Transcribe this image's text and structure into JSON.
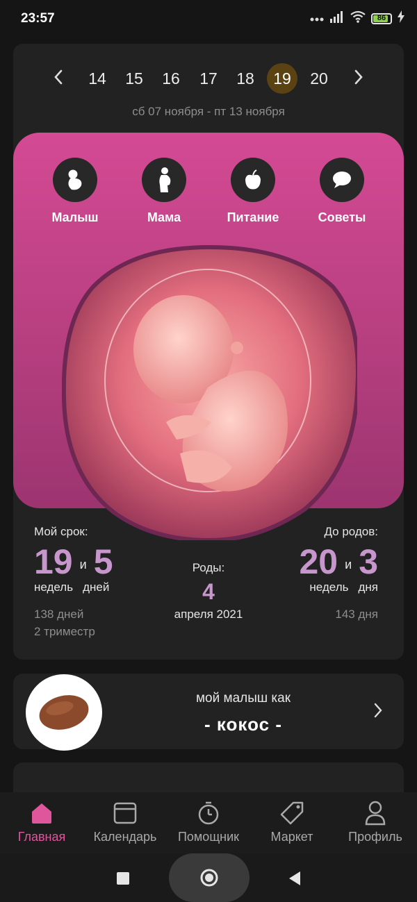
{
  "status": {
    "time": "23:57",
    "battery": "86"
  },
  "weeks": {
    "items": [
      "14",
      "15",
      "16",
      "17",
      "18",
      "19",
      "20"
    ],
    "active": "19",
    "date_range": "сб 07 ноября - пт 13 ноября"
  },
  "categories": [
    {
      "label": "Малыш",
      "icon": "baby-icon"
    },
    {
      "label": "Мама",
      "icon": "pregnant-woman-icon"
    },
    {
      "label": "Питание",
      "icon": "apple-icon"
    },
    {
      "label": "Советы",
      "icon": "chat-bubble-icon"
    }
  ],
  "term": {
    "title": "Мой срок:",
    "weeks": "19",
    "and": "и",
    "days": "5",
    "weeks_unit": "недель",
    "days_unit": "дней",
    "total_days": "138 дней",
    "trimester": "2 триместр"
  },
  "due": {
    "label": "Роды:",
    "day": "4",
    "month_year": "апреля 2021"
  },
  "remaining": {
    "title": "До родов:",
    "weeks": "20",
    "and": "и",
    "days": "3",
    "weeks_unit": "недель",
    "days_unit": "дня",
    "total_days": "143 дня"
  },
  "baby_size": {
    "line1": "мой малыш как",
    "fruit": "- кокос -",
    "icon": "coconut-icon"
  },
  "tabs": [
    {
      "label": "Главная",
      "icon": "home-icon",
      "active": true
    },
    {
      "label": "Календарь",
      "icon": "calendar-icon"
    },
    {
      "label": "Помощник",
      "icon": "timer-icon"
    },
    {
      "label": "Маркет",
      "icon": "tag-icon"
    },
    {
      "label": "Профиль",
      "icon": "user-icon"
    }
  ],
  "colors": {
    "accent": "#e0569d",
    "panel_pink": "#c94489",
    "number_purple": "#c796cc",
    "active_week": "#5b4212"
  }
}
